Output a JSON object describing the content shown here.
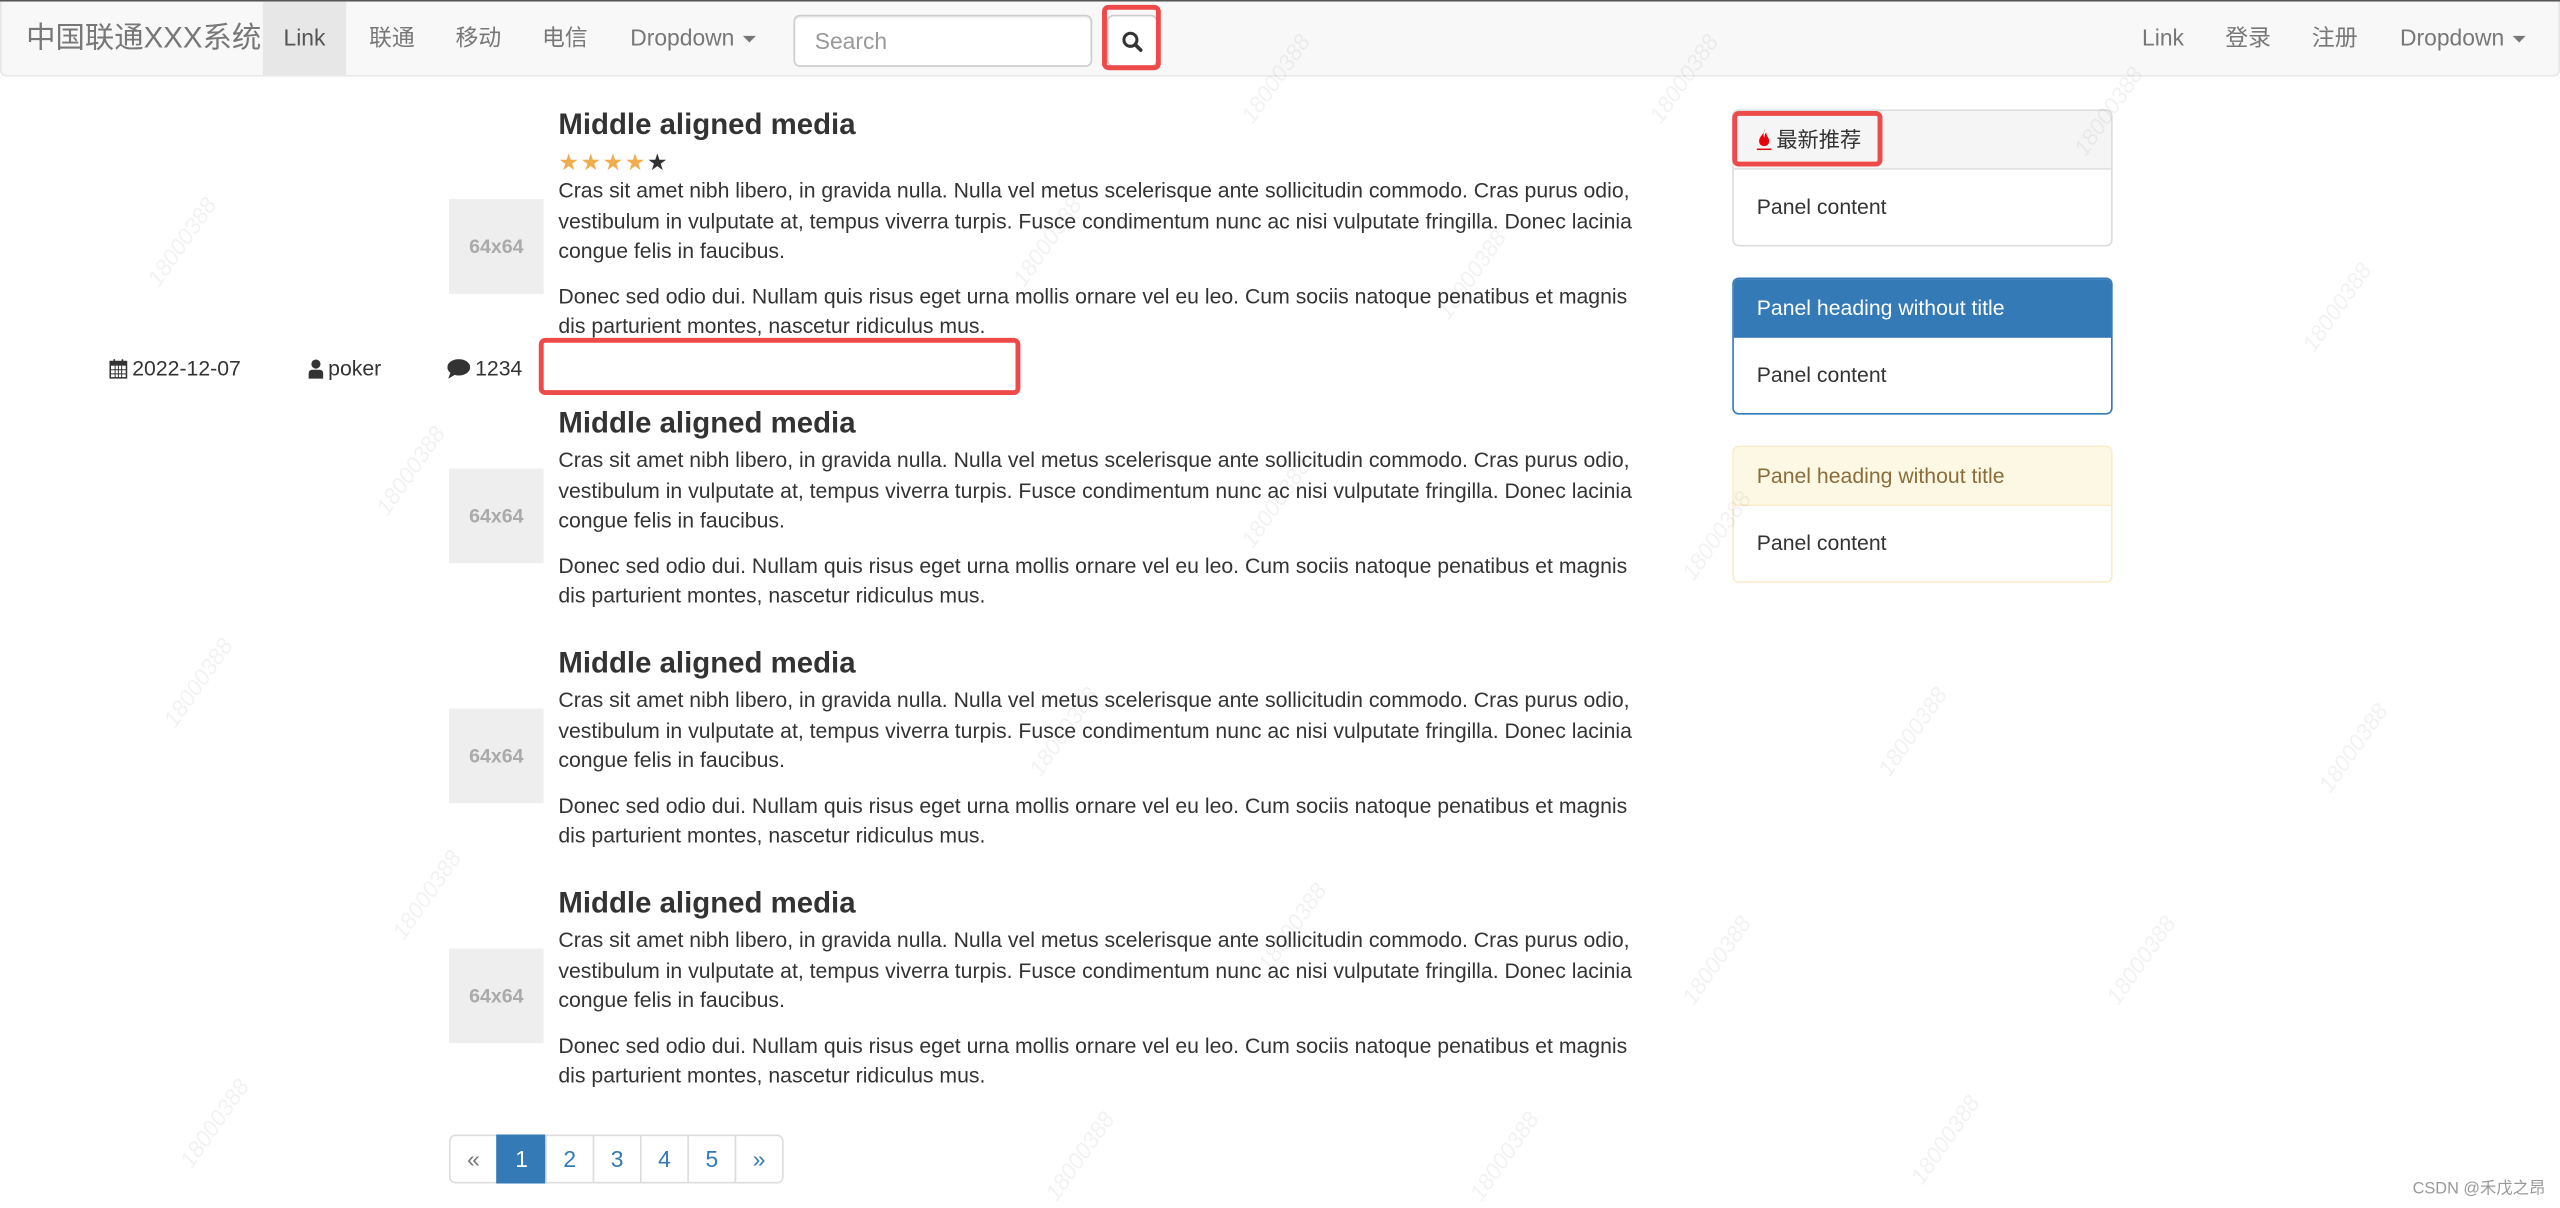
{
  "navbar": {
    "brand": "中国联通XXX系统",
    "left_items": [
      {
        "label": "Link",
        "active": true
      },
      {
        "label": "联通"
      },
      {
        "label": "移动"
      },
      {
        "label": "电信"
      },
      {
        "label": "Dropdown"
      }
    ],
    "search": {
      "placeholder": "Search",
      "value": ""
    },
    "right_items": [
      {
        "label": "Link"
      },
      {
        "label": "登录"
      },
      {
        "label": "注册"
      },
      {
        "label": "Dropdown"
      }
    ]
  },
  "media_list": [
    {
      "image_label": "64x64",
      "heading": "Middle aligned media",
      "rating": {
        "value": 4,
        "max": 5
      },
      "paragraphs": [
        "Cras sit amet nibh libero, in gravida nulla. Nulla vel metus scelerisque ante sollicitudin commodo. Cras purus odio, vestibulum in vulputate at, tempus viverra turpis. Fusce condimentum nunc ac nisi vulputate fringilla. Donec lacinia congue felis in faucibus.",
        "Donec sed odio dui. Nullam quis risus eget urna mollis ornare vel eu leo. Cum sociis natoque penatibus et magnis dis parturient montes, nascetur ridiculus mus."
      ],
      "meta": {
        "date": "2022-12-07",
        "author": "poker",
        "comments": "1234"
      }
    },
    {
      "image_label": "64x64",
      "heading": "Middle aligned media",
      "paragraphs": [
        "Cras sit amet nibh libero, in gravida nulla. Nulla vel metus scelerisque ante sollicitudin commodo. Cras purus odio, vestibulum in vulputate at, tempus viverra turpis. Fusce condimentum nunc ac nisi vulputate fringilla. Donec lacinia congue felis in faucibus.",
        "Donec sed odio dui. Nullam quis risus eget urna mollis ornare vel eu leo. Cum sociis natoque penatibus et magnis dis parturient montes, nascetur ridiculus mus."
      ]
    },
    {
      "image_label": "64x64",
      "heading": "Middle aligned media",
      "paragraphs": [
        "Cras sit amet nibh libero, in gravida nulla. Nulla vel metus scelerisque ante sollicitudin commodo. Cras purus odio, vestibulum in vulputate at, tempus viverra turpis. Fusce condimentum nunc ac nisi vulputate fringilla. Donec lacinia congue felis in faucibus.",
        "Donec sed odio dui. Nullam quis risus eget urna mollis ornare vel eu leo. Cum sociis natoque penatibus et magnis dis parturient montes, nascetur ridiculus mus."
      ]
    },
    {
      "image_label": "64x64",
      "heading": "Middle aligned media",
      "paragraphs": [
        "Cras sit amet nibh libero, in gravida nulla. Nulla vel metus scelerisque ante sollicitudin commodo. Cras purus odio, vestibulum in vulputate at, tempus viverra turpis. Fusce condimentum nunc ac nisi vulputate fringilla. Donec lacinia congue felis in faucibus.",
        "Donec sed odio dui. Nullam quis risus eget urna mollis ornare vel eu leo. Cum sociis natoque penatibus et magnis dis parturient montes, nascetur ridiculus mus."
      ]
    }
  ],
  "sidebar": {
    "panels": [
      {
        "style": "default",
        "heading": "最新推荐",
        "heading_icon": "fire-icon",
        "body": "Panel content"
      },
      {
        "style": "primary",
        "heading": "Panel heading without title",
        "body": "Panel content"
      },
      {
        "style": "warning",
        "heading": "Panel heading without title",
        "body": "Panel content"
      }
    ]
  },
  "pagination": {
    "prev": "«",
    "pages": [
      "1",
      "2",
      "3",
      "4",
      "5"
    ],
    "active_page": "1",
    "next": "»"
  },
  "colors": {
    "primary": "#337ab7",
    "star": "#f0ad4e",
    "highlight": "#ef4a4a",
    "fire": "#e8000b"
  },
  "watermark": "18000388",
  "footer_mark": "CSDN @禾戊之昂"
}
